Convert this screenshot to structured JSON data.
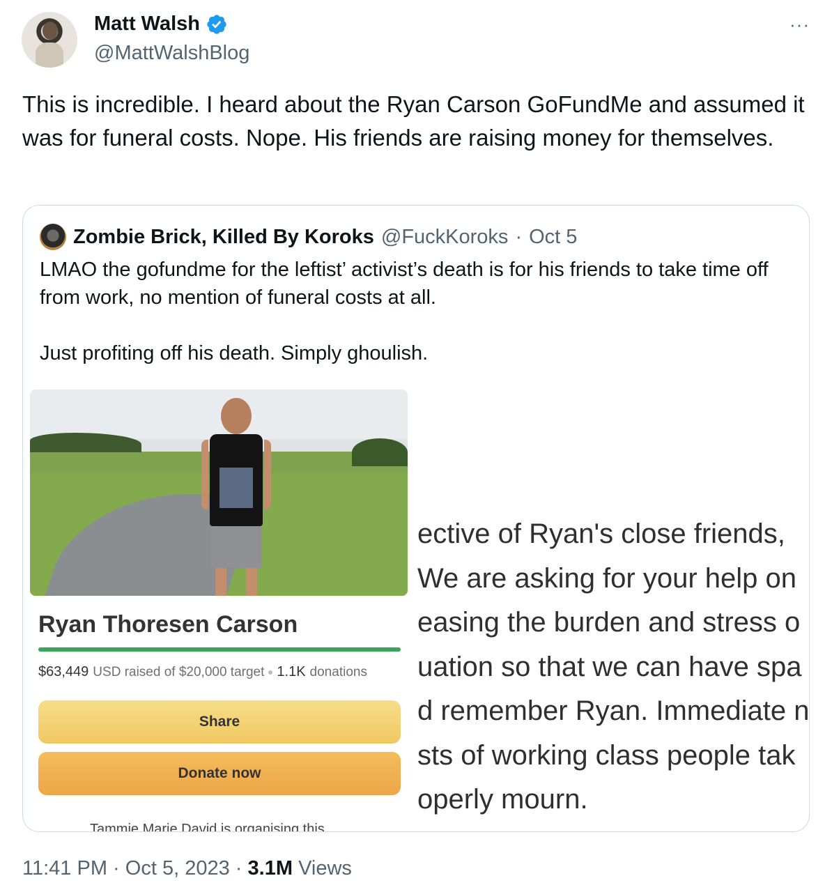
{
  "author": {
    "display_name": "Matt Walsh",
    "handle": "@MattWalshBlog",
    "verified": true,
    "verified_icon": "verified-badge-icon",
    "verified_color": "#1d9bf0"
  },
  "more_label": "···",
  "tweet_text": "This is incredible. I heard about the Ryan Carson GoFundMe and assumed it was for funeral costs. Nope. His friends are raising money for themselves.",
  "quote": {
    "author_name": "Zombie Brick, Killed By Koroks",
    "handle": "@FuckKoroks",
    "separator": "·",
    "date": "Oct 5",
    "text": "LMAO the gofundme for the leftist’ activist’s death is for his friends to take time off from work, no mention of funeral costs at all.\n\nJust profiting off his death. Simply ghoulish.",
    "image": {
      "fundraiser_title": "Ryan Thoresen Carson",
      "raised": "$63,449",
      "raised_suffix": "USD raised of $20,000 target",
      "donations_count": "1.1K",
      "donations_label": "donations",
      "progress_fraction": 1.0,
      "progress_color": "#3aa65a",
      "share_label": "Share",
      "donate_label": "Donate now",
      "organiser_text": "Tammie Marie David is organising this",
      "excerpt_lines": [
        "ective of Ryan's close friends,",
        "We are asking for your help on",
        "easing the burden and stress o",
        "uation so that we can have spa",
        "d remember Ryan. Immediate n",
        "sts of working class people tak",
        "operly mourn."
      ]
    }
  },
  "meta": {
    "time": "11:41 PM",
    "date": "Oct 5, 2023",
    "separator": "·",
    "views_count": "3.1M",
    "views_label": "Views"
  }
}
